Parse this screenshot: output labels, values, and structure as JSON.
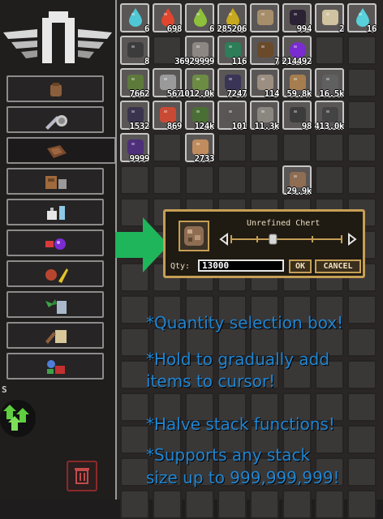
{
  "sidebar": {
    "letter": "S",
    "categories": [
      {
        "name": "all"
      },
      {
        "name": "tools"
      },
      {
        "name": "materials"
      },
      {
        "name": "furniture"
      },
      {
        "name": "placeables"
      },
      {
        "name": "consumables"
      },
      {
        "name": "food"
      },
      {
        "name": "plants"
      },
      {
        "name": "crafting"
      },
      {
        "name": "misc"
      }
    ]
  },
  "inventory": {
    "items": [
      {
        "slot": 0,
        "icon": "water-droplet-icon",
        "color": "#4fc7d4",
        "count": "6"
      },
      {
        "slot": 1,
        "icon": "red-droplet-icon",
        "color": "#e0452e",
        "count": "698"
      },
      {
        "slot": 2,
        "icon": "green-droplet-icon",
        "color": "#8ec13b",
        "count": "6"
      },
      {
        "slot": 3,
        "icon": "yellow-droplet-icon",
        "color": "#c7a81e",
        "count": "285206"
      },
      {
        "slot": 4,
        "icon": "sandstone-block-icon",
        "color": "#a78e6a",
        "count": ""
      },
      {
        "slot": 5,
        "icon": "dark-block-icon",
        "color": "#2b2233",
        "count": "994"
      },
      {
        "slot": 6,
        "icon": "bone-creature-icon",
        "color": "#cfc3a0",
        "count": "2"
      },
      {
        "slot": 7,
        "icon": "cyan-droplet-icon",
        "color": "#58d1da",
        "count": "16"
      },
      {
        "slot": 8,
        "icon": "anvil-icon",
        "color": "#3c3c3c",
        "count": "8"
      },
      {
        "slot": 10,
        "icon": "cobble-block-icon",
        "color": "#8d8783",
        "count": "36929999"
      },
      {
        "slot": 11,
        "icon": "log-icon",
        "color": "#2c7d58",
        "count": "116"
      },
      {
        "slot": 12,
        "icon": "chest-icon",
        "color": "#6a4a2a",
        "count": "7"
      },
      {
        "slot": 13,
        "icon": "purple-orb-icon",
        "color": "#7a2bd1",
        "count": "214492"
      },
      {
        "slot": 16,
        "icon": "mossy-block-icon",
        "color": "#5d7a3b",
        "count": "7662"
      },
      {
        "slot": 17,
        "icon": "stone-block-icon",
        "color": "#9a9a9a",
        "count": "567"
      },
      {
        "slot": 18,
        "icon": "moss-ball-icon",
        "color": "#6c8c43",
        "count": "1012.0k"
      },
      {
        "slot": 19,
        "icon": "obsidian-block-icon",
        "color": "#3a3557",
        "count": "7247"
      },
      {
        "slot": 20,
        "icon": "clay-block-icon",
        "color": "#9c8f82",
        "count": "114"
      },
      {
        "slot": 21,
        "icon": "wood-log-icon",
        "color": "#a57d4f",
        "count": "59.8k"
      },
      {
        "slot": 22,
        "icon": "slate-block-icon",
        "color": "#606060",
        "count": "16.5k"
      },
      {
        "slot": 24,
        "icon": "dark-stone-icon",
        "color": "#3b344e",
        "count": "1532"
      },
      {
        "slot": 25,
        "icon": "flower-cluster-icon",
        "color": "#c94a34",
        "count": "869"
      },
      {
        "slot": 26,
        "icon": "leaf-block-icon",
        "color": "#4a6f34",
        "count": "124k"
      },
      {
        "slot": 27,
        "icon": "stone-chunk-icon",
        "color": "#5a5555",
        "count": "101"
      },
      {
        "slot": 28,
        "icon": "gravel-block-icon",
        "color": "#8a8680",
        "count": "11.3k"
      },
      {
        "slot": 29,
        "icon": "dirt-block-icon",
        "color": "#3d3c3c",
        "count": "98"
      },
      {
        "slot": 30,
        "icon": "coal-block-icon",
        "color": "#444444",
        "count": "413.0k"
      },
      {
        "slot": 32,
        "icon": "crystal-block-icon",
        "color": "#4d2f7a",
        "count": "9999"
      },
      {
        "slot": 34,
        "icon": "plank-block-icon",
        "color": "#c08c5e",
        "count": "2733"
      },
      {
        "slot": 45,
        "icon": "unrefined-chert-icon",
        "color": "#8e6d53",
        "count": "29.9k"
      }
    ]
  },
  "quantity_dialog": {
    "title": "Unrefined Chert",
    "qty_label": "Qty:",
    "qty_value": "13000",
    "ok_label": "OK",
    "cancel_label": "CANCEL",
    "slider_fraction": 0.38
  },
  "annotations": {
    "line1": "*Quantity selection box!",
    "line2a": "*Hold to gradually add",
    "line2b": "items to cursor!",
    "line3": "*Halve stack functions!",
    "line4a": "*Supports any stack",
    "line4b": "size up to 999,999,999!"
  },
  "colors": {
    "accent_gold": "#c59f55",
    "annotation_blue": "#1f86d2",
    "arrow_green": "#1fb55a"
  }
}
